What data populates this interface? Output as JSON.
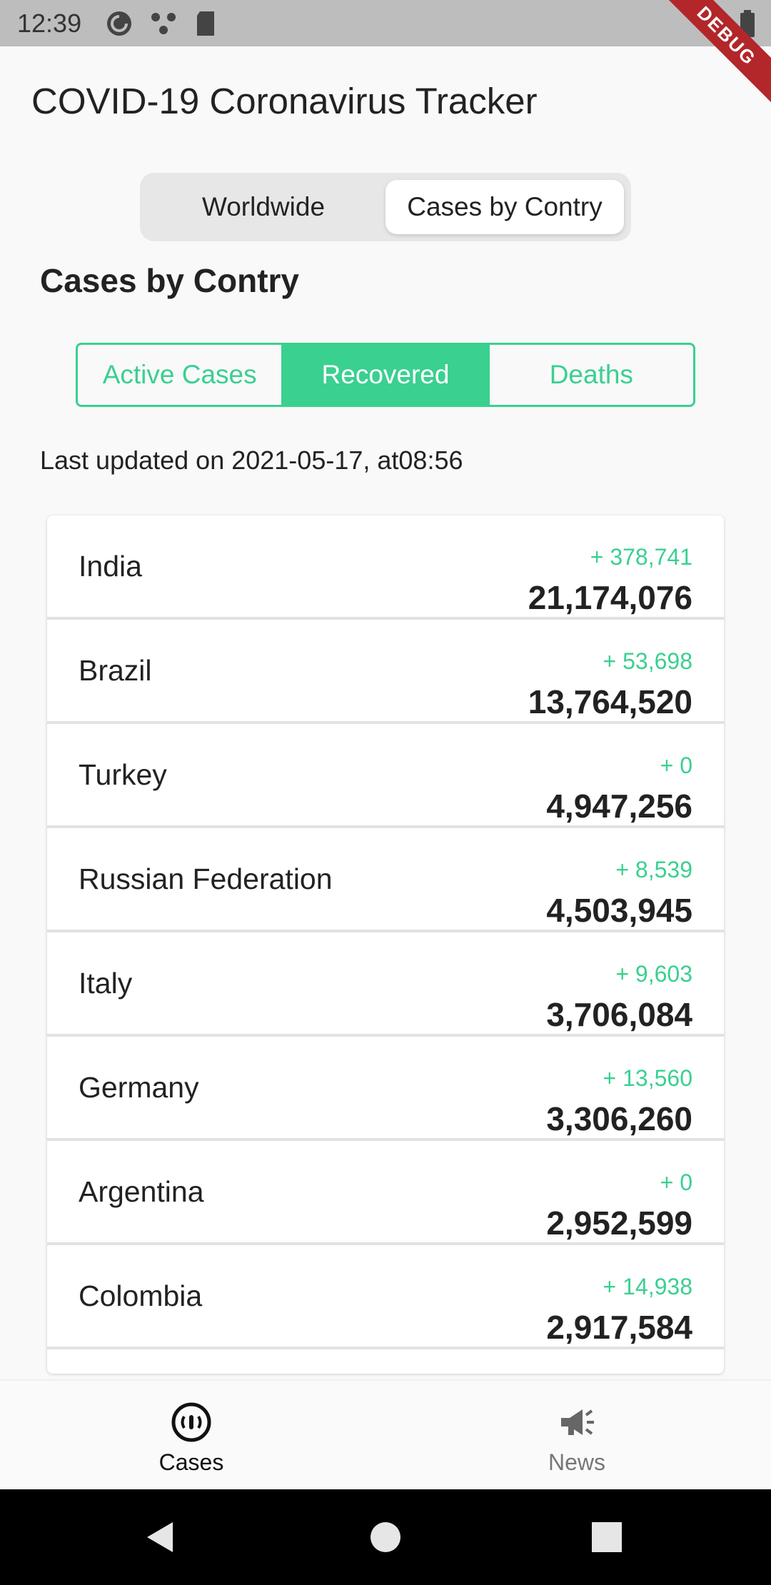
{
  "status_bar": {
    "time": "12:39",
    "debug_label": "DEBUG"
  },
  "app": {
    "title": "COVID-19 Coronavirus Tracker"
  },
  "segments": {
    "worldwide": "Worldwide",
    "by_country": "Cases by Contry",
    "selected": "Cases by Contry"
  },
  "section": {
    "heading": "Cases by Contry"
  },
  "toggle": {
    "active_cases": "Active Cases",
    "recovered": "Recovered",
    "deaths": "Deaths",
    "selected": "Recovered"
  },
  "last_updated": "Last updated on 2021-05-17, at08:56",
  "rows": [
    {
      "country": "India",
      "delta": "+ 378,741",
      "total": "21,174,076"
    },
    {
      "country": "Brazil",
      "delta": "+ 53,698",
      "total": "13,764,520"
    },
    {
      "country": "Turkey",
      "delta": "+ 0",
      "total": "4,947,256"
    },
    {
      "country": "Russian Federation",
      "delta": "+ 8,539",
      "total": "4,503,945"
    },
    {
      "country": "Italy",
      "delta": "+ 9,603",
      "total": "3,706,084"
    },
    {
      "country": "Germany",
      "delta": "+ 13,560",
      "total": "3,306,260"
    },
    {
      "country": "Argentina",
      "delta": "+ 0",
      "total": "2,952,599"
    },
    {
      "country": "Colombia",
      "delta": "+ 14,938",
      "total": "2,917,584"
    }
  ],
  "bottom_nav": {
    "cases": "Cases",
    "news": "News",
    "selected": "Cases"
  },
  "colors": {
    "accent": "#3ad090",
    "debug_ribbon": "#b3262a"
  },
  "icons": {
    "status": [
      "pocket-casts-icon",
      "share-dots-icon",
      "sd-card-icon",
      "wifi-icon",
      "battery-icon"
    ],
    "cases_tab": "virus-radar-icon",
    "news_tab": "megaphone-icon",
    "system": [
      "back-icon",
      "home-icon",
      "recents-icon"
    ]
  }
}
